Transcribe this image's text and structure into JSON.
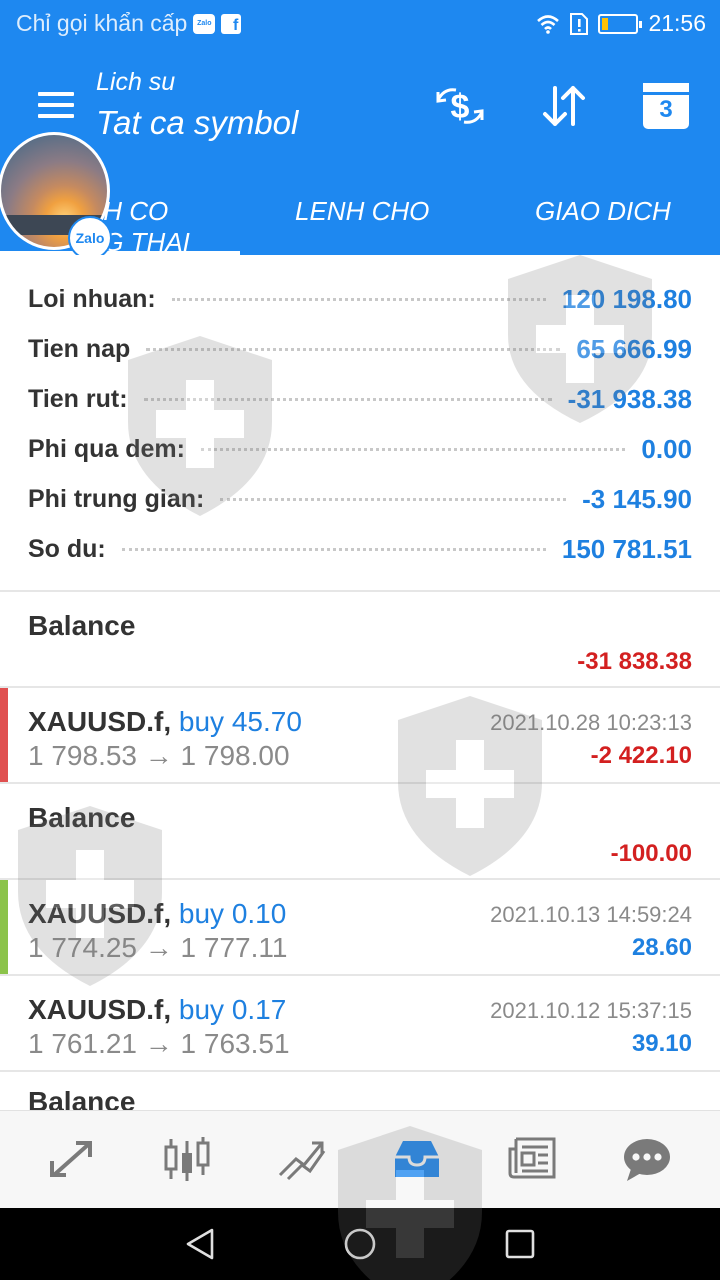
{
  "status_bar": {
    "carrier_text": "Chỉ gọi khẩn cấp",
    "zalo_label": "Zalo",
    "fb_label": "f",
    "time": "21:56",
    "battery_level": 0.2
  },
  "header": {
    "subtitle": "Lich su",
    "title": "Tat ca symbol",
    "calendar_number": "3"
  },
  "tabs": [
    {
      "label": "IH CO\nIG THAI"
    },
    {
      "label": "LENH CHO"
    },
    {
      "label": "GIAO DICH"
    }
  ],
  "avatar_badge": "Zalo",
  "summary": [
    {
      "label": "Loi nhuan:",
      "value": "120 198.80"
    },
    {
      "label": "Tien nap",
      "value": "65 666.99"
    },
    {
      "label": "Tien rut:",
      "value": "-31 938.38"
    },
    {
      "label": "Phi qua dem:",
      "value": "0.00"
    },
    {
      "label": "Phi trung gian:",
      "value": "-3 145.90"
    },
    {
      "label": "So du:",
      "value": "150 781.51"
    }
  ],
  "history": [
    {
      "kind": "balance",
      "title": "Balance",
      "profit": "-31 838.38",
      "profit_sign": "neg"
    },
    {
      "kind": "trade",
      "symbol": "XAUUSD.f,",
      "side": "buy 45.70",
      "prices": "1 798.53 → 1 798.00",
      "time": "2021.10.28 10:23:13",
      "profit": "-2 422.10",
      "profit_sign": "neg",
      "marker": "#e05050"
    },
    {
      "kind": "balance",
      "title": "Balance",
      "profit": "-100.00",
      "profit_sign": "neg"
    },
    {
      "kind": "trade",
      "symbol": "XAUUSD.f,",
      "side": "buy 0.10",
      "prices": "1 774.25 → 1 777.11",
      "time": "2021.10.13 14:59:24",
      "profit": "28.60",
      "profit_sign": "pos",
      "marker": "#8bc34a"
    },
    {
      "kind": "trade",
      "symbol": "XAUUSD.f,",
      "side": "buy 0.17",
      "prices": "1 761.21 → 1 763.51",
      "time": "2021.10.12 15:37:15",
      "profit": "39.10",
      "profit_sign": "pos",
      "marker": ""
    },
    {
      "kind": "balance",
      "title": "Balance",
      "profit": "",
      "profit_sign": "neg"
    }
  ],
  "bottom_nav": [
    {
      "icon": "quotes-arrows-icon"
    },
    {
      "icon": "candlestick-chart-icon"
    },
    {
      "icon": "trade-trend-icon"
    },
    {
      "icon": "history-inbox-icon",
      "active": true
    },
    {
      "icon": "news-icon"
    },
    {
      "icon": "chat-icon"
    }
  ],
  "colors": {
    "primary": "#1e88f0",
    "positive": "#1e80e0",
    "negative": "#d32020"
  }
}
